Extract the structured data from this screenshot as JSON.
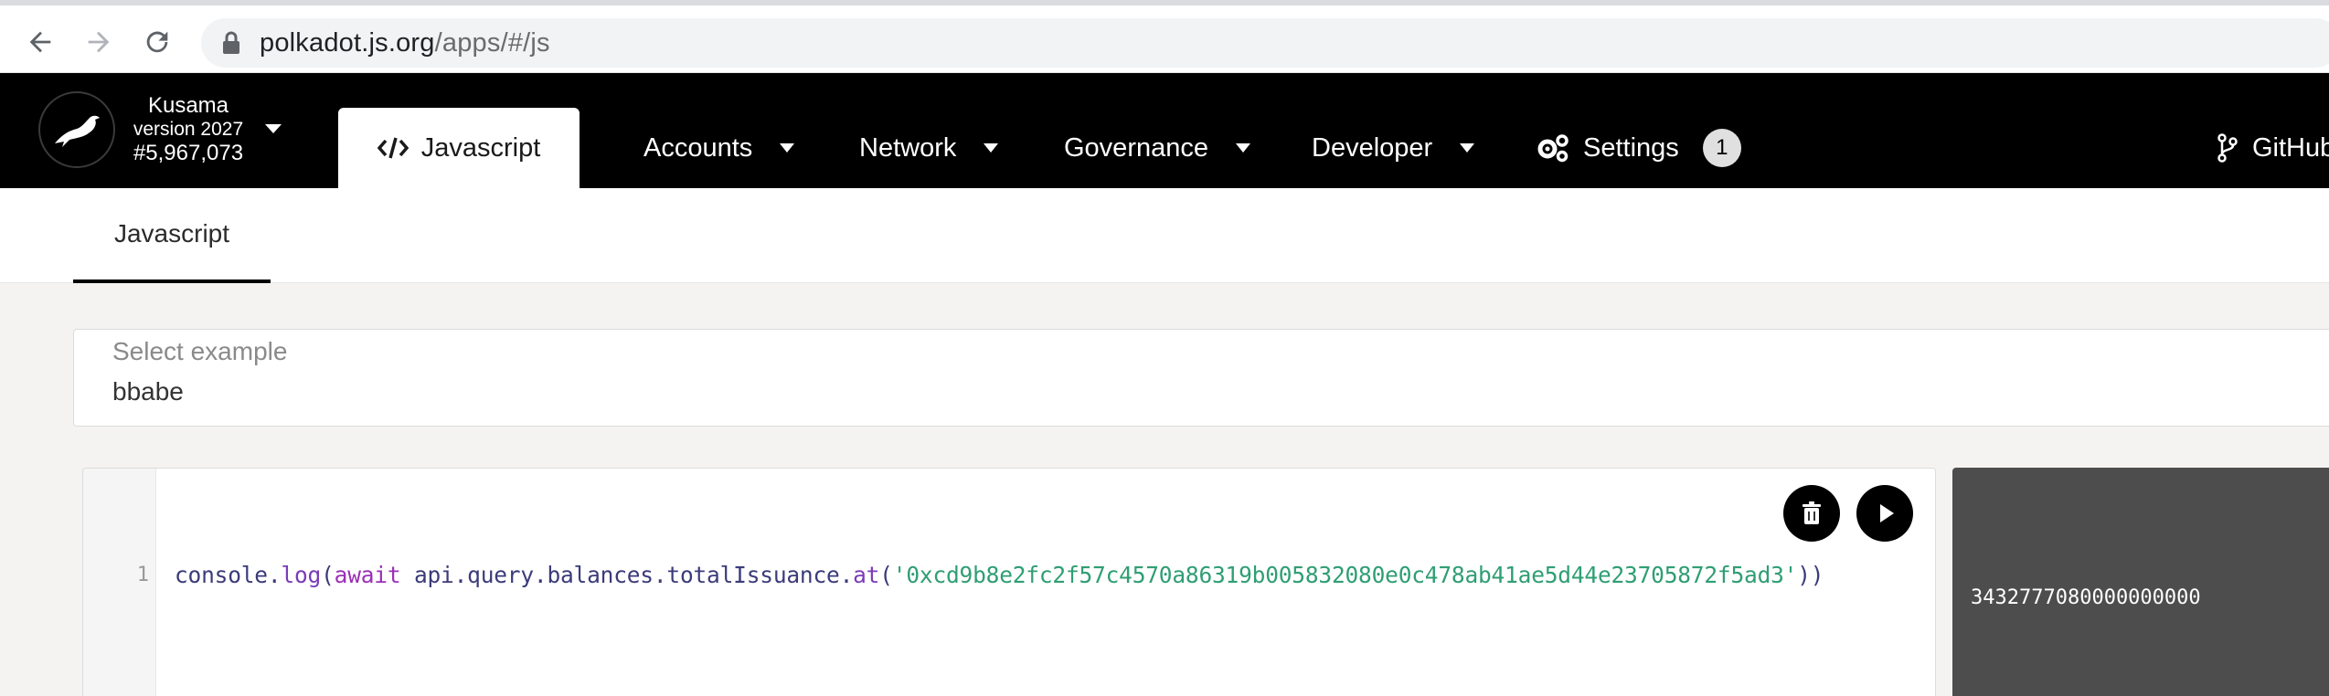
{
  "browser": {
    "url_host": "polkadot.js.org",
    "url_path": "/apps/#/js"
  },
  "chain": {
    "name": "Kusama",
    "version": "version 2027",
    "block": "#5,967,073"
  },
  "nav": {
    "active_tab": "Javascript",
    "items": [
      {
        "label": "Accounts"
      },
      {
        "label": "Network"
      },
      {
        "label": "Governance"
      },
      {
        "label": "Developer"
      }
    ],
    "settings_label": "Settings",
    "settings_badge": "1",
    "github_label": "GitHub"
  },
  "subheader": {
    "tab": "Javascript"
  },
  "select": {
    "label": "Select example",
    "value": "bbabe"
  },
  "editor": {
    "line_number": "1",
    "tokens": {
      "t1": "console",
      "t2": ".",
      "t3": "log",
      "t4": "(",
      "t5": "await",
      "t6": " api.query.balances.totalIssuance.",
      "t7": "at",
      "t8": "(",
      "t9": "'0xcd9b8e2fc2f57c4570a86319b005832080e0c478ab41ae5d44e23705872f5ad3'",
      "t10": "))"
    },
    "icons": [
      "trash-icon",
      "play-icon"
    ]
  },
  "output": {
    "value": "3432777080000000000"
  },
  "colors": {
    "nav_bg": "#000000",
    "string": "#2f9e74",
    "keyword": "#9b2fb6",
    "identifier": "#3b3b7a",
    "output_bg": "#4d4d4d"
  }
}
